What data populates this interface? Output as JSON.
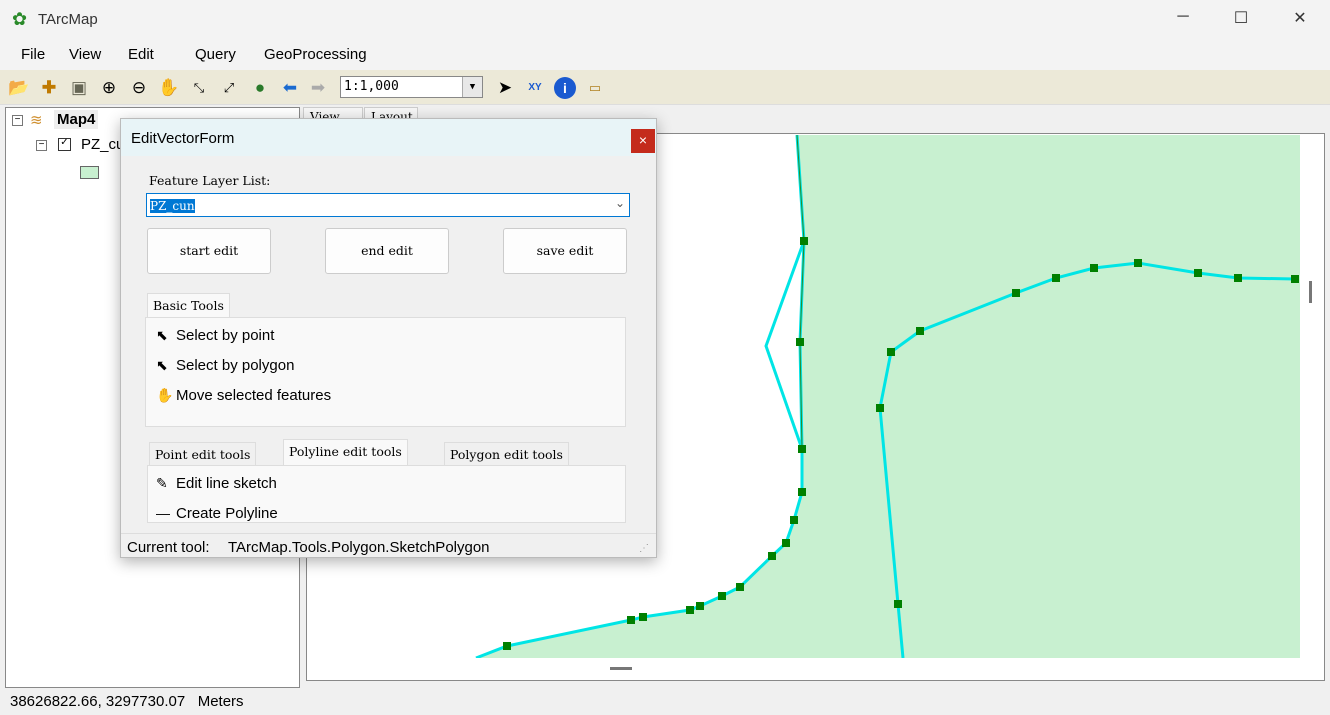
{
  "window": {
    "title": "TArcMap",
    "minimize": "─",
    "maximize": "☐",
    "close": "✕"
  },
  "menu": [
    "File",
    "View",
    "Edit",
    "Query",
    "GeoProcessing"
  ],
  "toolbar": {
    "scale": "1:1,000",
    "icons": [
      "open-folder-icon",
      "add-data-icon",
      "save-icon",
      "zoom-in-icon",
      "zoom-out-icon",
      "pan-hand-icon",
      "zoom-to-extent-icon",
      "full-extent-icon",
      "globe-icon",
      "back-arrow-icon",
      "forward-arrow-icon"
    ],
    "right_icons": [
      "select-arrow-icon",
      "xy-locate-icon",
      "info-icon",
      "measure-icon"
    ]
  },
  "toc": {
    "map": "Map4",
    "layer": "PZ_cun",
    "fill_color": "#c8f0d0"
  },
  "view_tabs": [
    "View",
    "Layout"
  ],
  "map": {
    "fill": "#c8f0d0",
    "line": "#00e5e5",
    "vertex": "#008000"
  },
  "dialog": {
    "title": "EditVectorForm",
    "close": "×",
    "layer_list_label": "Feature Layer List:",
    "layer_value": "PZ_cun",
    "buttons": [
      "start edit",
      "end edit",
      "save edit"
    ],
    "basic_tab": "Basic Tools",
    "basic_tools": [
      "Select by point",
      "Select by polygon",
      "Move selected features"
    ],
    "edit_tabs": [
      "Point edit tools",
      "Polyline edit tools",
      "Polygon edit tools"
    ],
    "polyline_tools": [
      "Edit line sketch",
      "Create Polyline"
    ],
    "current_tool_label": "Current tool:",
    "current_tool": "TArcMap.Tools.Polygon.SketchPolygon"
  },
  "status": {
    "coords": "38626822.66, 3297730.07",
    "units": "Meters"
  }
}
